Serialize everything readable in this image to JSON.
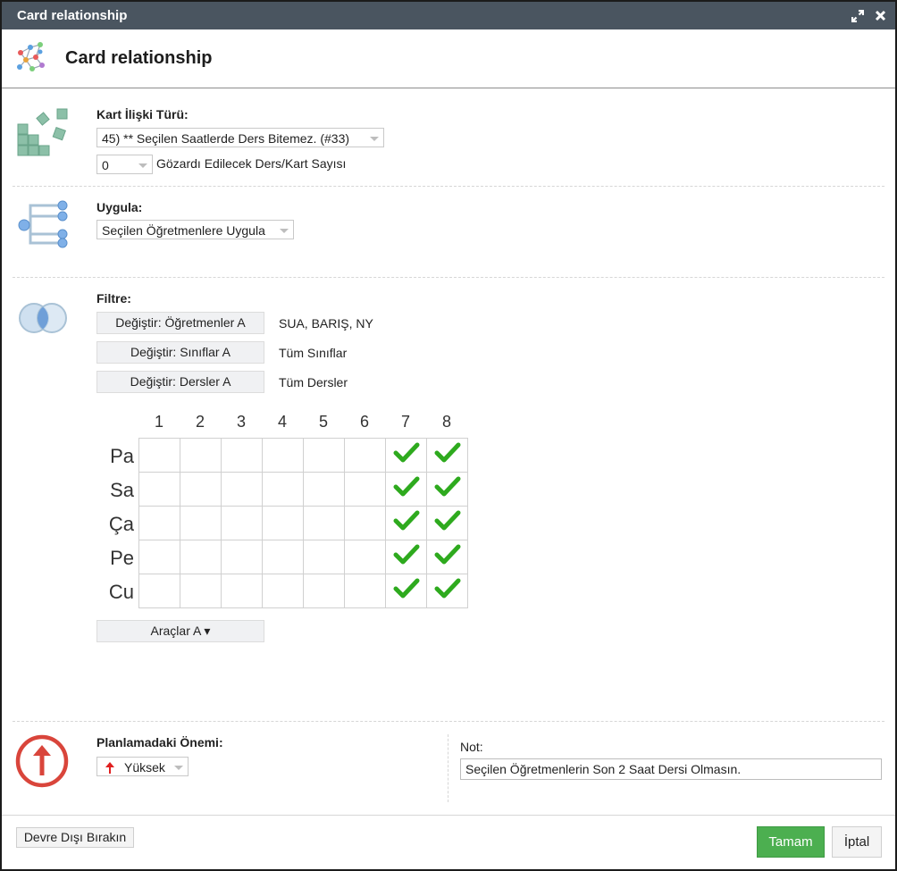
{
  "window": {
    "title": "Card relationship"
  },
  "header": {
    "title": "Card relationship"
  },
  "relation": {
    "label": "Kart İlişki Türü:",
    "type_value": "45) ** Seçilen Saatlerde Ders Bitemez. (#33)",
    "ignore_value": "0",
    "ignore_label": "Gözardı Edilecek Ders/Kart Sayısı"
  },
  "apply": {
    "label": "Uygula:",
    "value": "Seçilen Öğretmenlere Uygula"
  },
  "filter": {
    "label": "Filtre:",
    "teachers_button": "Değiştir: Öğretmenler A",
    "teachers_value": "SUA, BARIŞ, NY",
    "classes_button": "Değiştir: Sınıflar A",
    "classes_value": "Tüm Sınıflar",
    "subjects_button": "Değiştir: Dersler A",
    "subjects_value": "Tüm Dersler"
  },
  "timetable": {
    "periods": [
      "1",
      "2",
      "3",
      "4",
      "5",
      "6",
      "7",
      "8"
    ],
    "days": [
      "Pa",
      "Sa",
      "Ça",
      "Pe",
      "Cu"
    ],
    "checked": [
      [
        false,
        false,
        false,
        false,
        false,
        false,
        true,
        true
      ],
      [
        false,
        false,
        false,
        false,
        false,
        false,
        true,
        true
      ],
      [
        false,
        false,
        false,
        false,
        false,
        false,
        true,
        true
      ],
      [
        false,
        false,
        false,
        false,
        false,
        false,
        true,
        true
      ],
      [
        false,
        false,
        false,
        false,
        false,
        false,
        true,
        true
      ]
    ],
    "tools_button": "Araçlar A ▾"
  },
  "importance": {
    "label": "Planlamadaki Önemi:",
    "value": "Yüksek"
  },
  "note": {
    "label": "Not:",
    "value": "Seçilen Öğretmenlerin Son 2 Saat Dersi Olmasın."
  },
  "footer": {
    "disable_button": "Devre Dışı Bırakın",
    "ok_button": "Tamam",
    "cancel_button": "İptal"
  },
  "colors": {
    "titlebar": "#4a5560",
    "check": "#2eaa1e",
    "ok_button": "#4caf50",
    "importance_icon": "#d9453b"
  },
  "icons": {
    "maximize": "expand-icon",
    "close": "close-icon",
    "header": "network-icon",
    "relation": "blocks-icon",
    "apply": "tree-icon",
    "filter": "venn-icon",
    "importance": "up-arrow-circle-icon"
  }
}
